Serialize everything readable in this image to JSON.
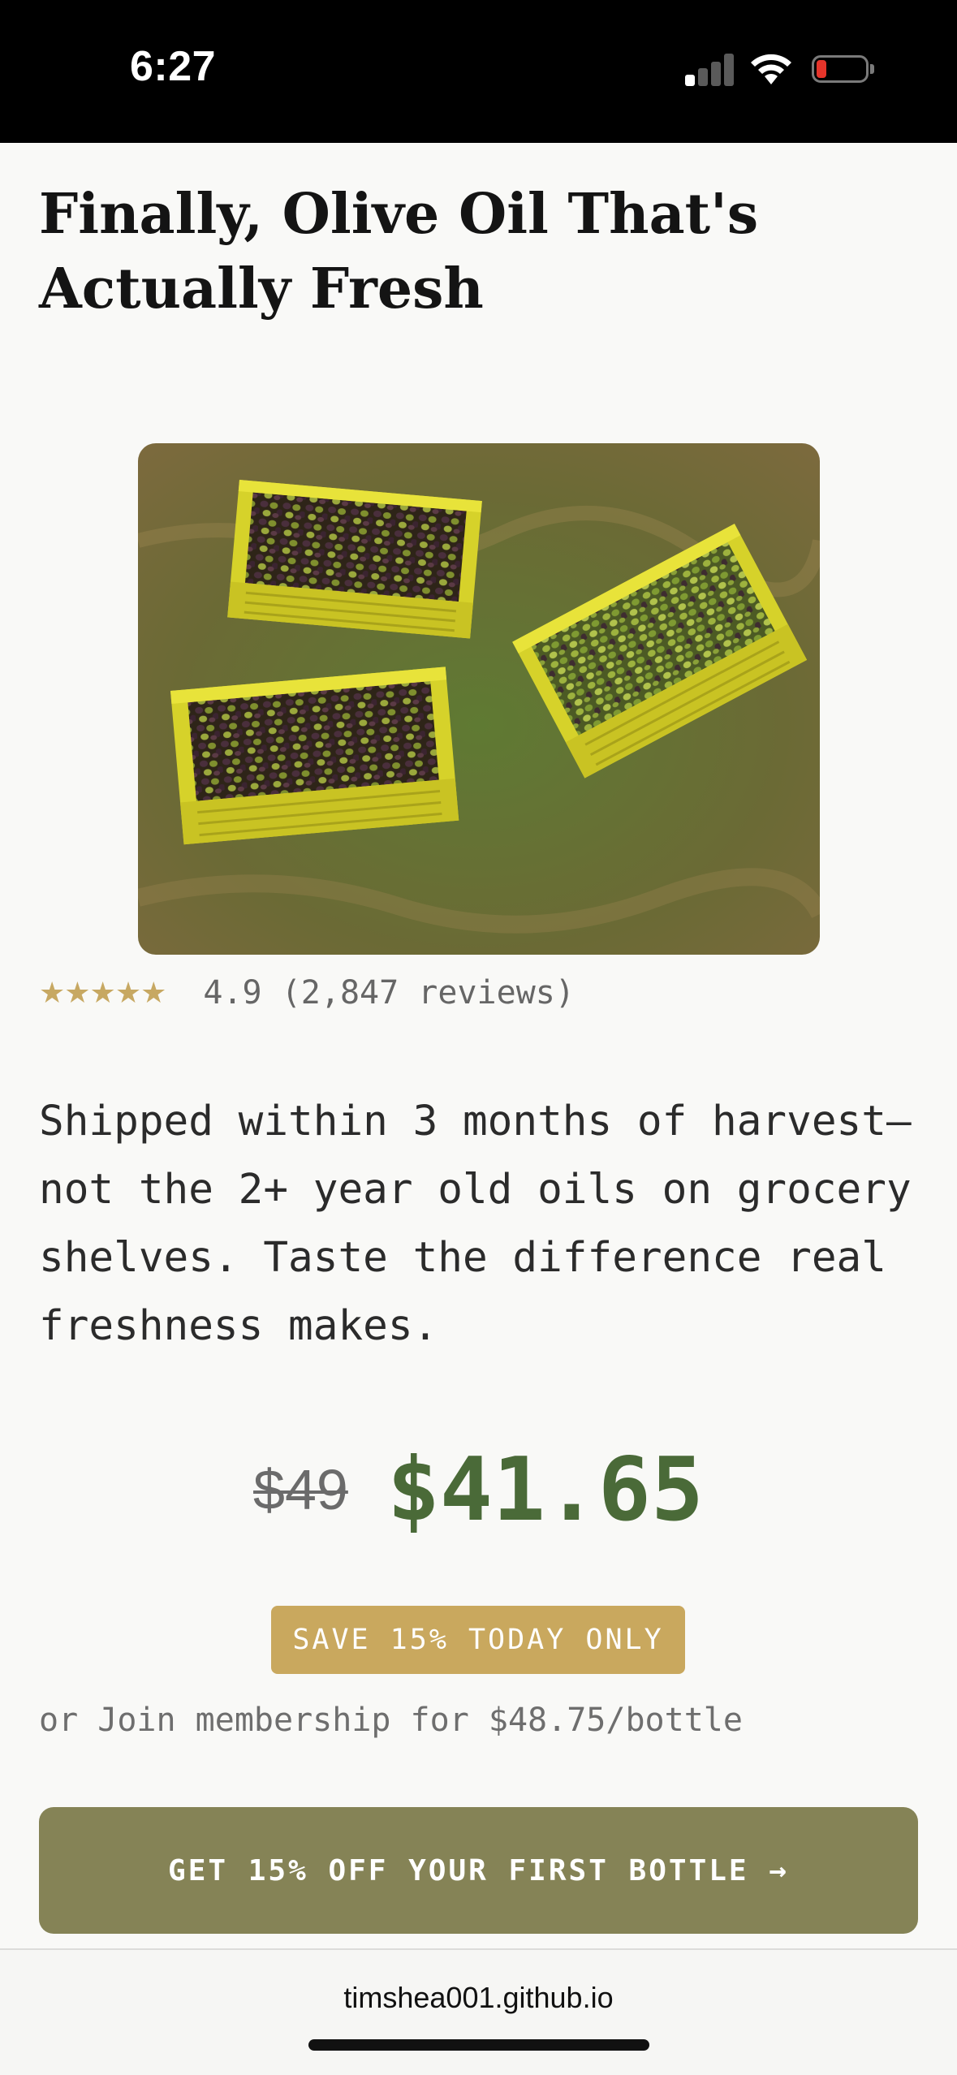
{
  "status_bar": {
    "time": "6:27",
    "signal_bars_active": 1,
    "battery_level": 0.15,
    "battery_color": "#e5342a"
  },
  "product": {
    "headline": "Finally, Olive Oil That's Actually Fresh",
    "image_icon": "olive-crates-photo",
    "rating": {
      "stars": "★★★★★",
      "text": "4.9 (2,847 reviews)",
      "star_color": "#c7a862"
    },
    "description": "Shipped within 3 months of harvest—not the 2+ year old oils on grocery shelves. Taste the difference real freshness makes.",
    "old_price": "$49",
    "new_price": "$41.65",
    "price_color": "#4a6a38",
    "save_badge": "SAVE 15% TODAY ONLY",
    "membership_text": "or Join membership for $48.75/bottle",
    "cta_label": "GET 15% OFF YOUR FIRST BOTTLE →"
  },
  "browser": {
    "url": "timshea001.github.io"
  }
}
